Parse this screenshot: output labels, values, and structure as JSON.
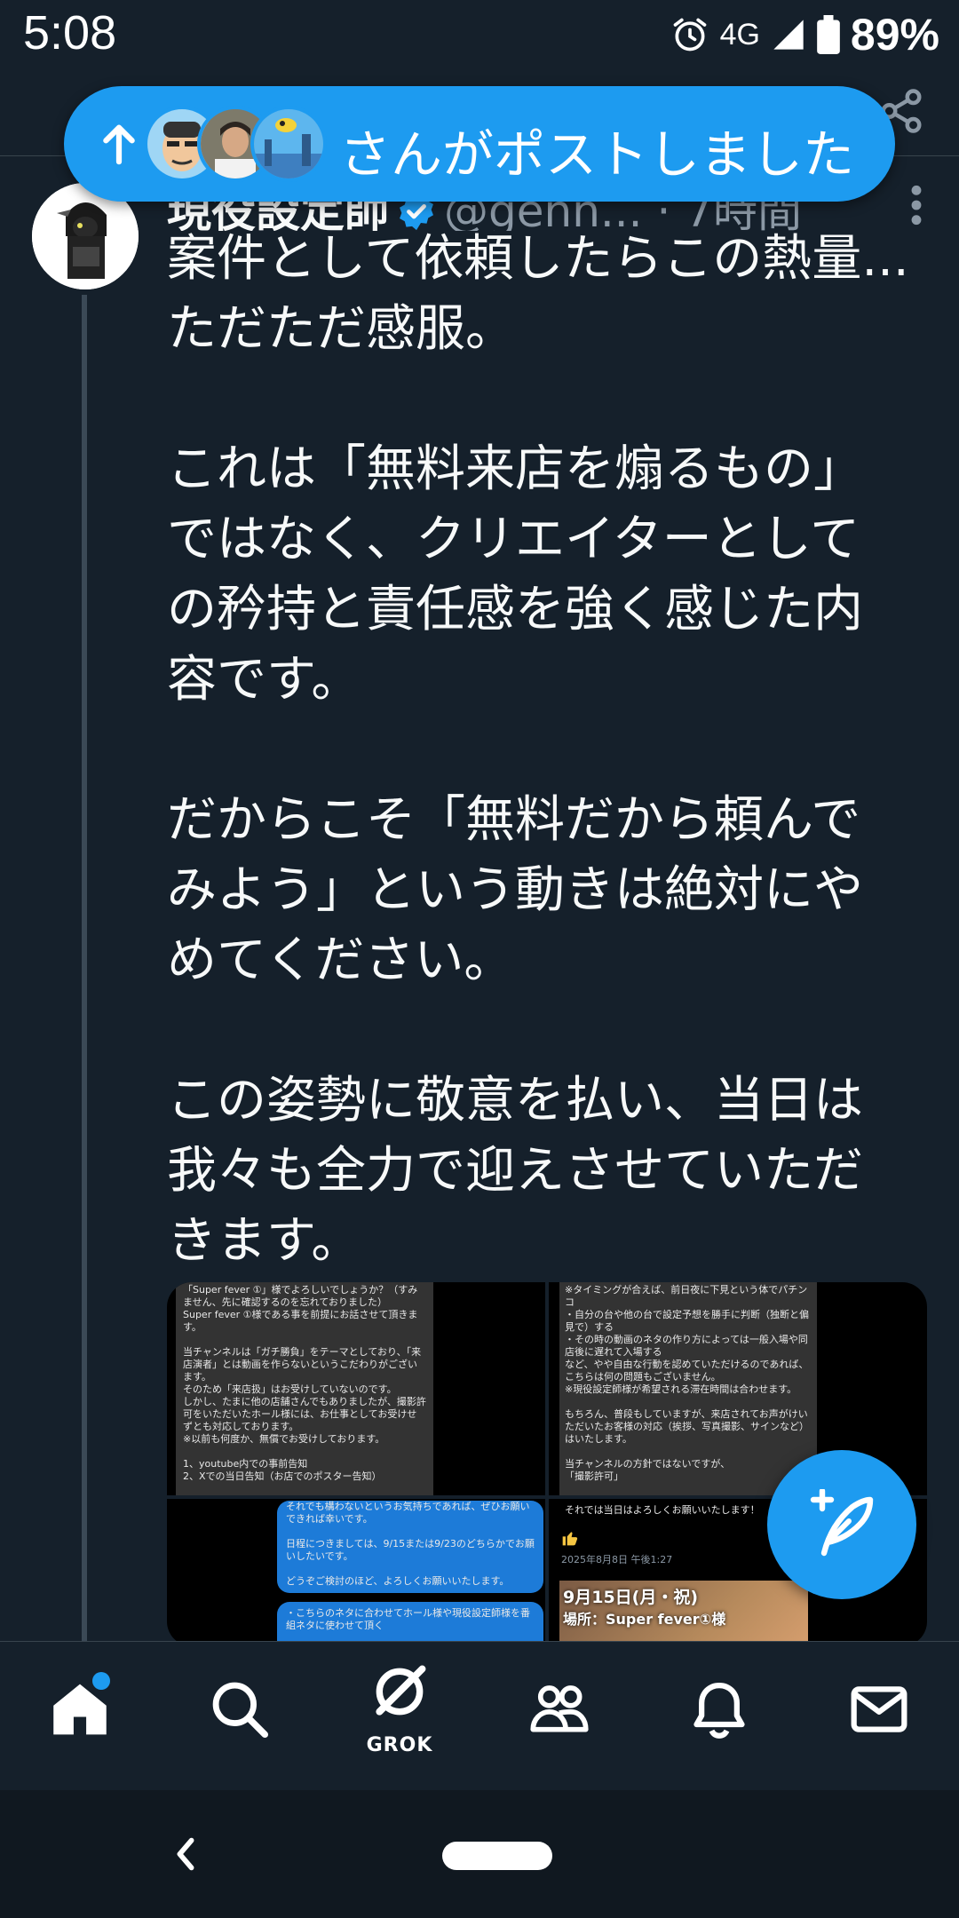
{
  "status_bar": {
    "time": "5:08",
    "network": "4G",
    "battery": "89%",
    "icons": [
      "alarm-icon",
      "signal-icon",
      "battery-icon"
    ]
  },
  "new_posts_pill": {
    "text": "さんがポストしました",
    "icon": "arrow-up-icon",
    "avatar_count": 3
  },
  "tweet": {
    "author_name": "現役設定師",
    "handle_time": "@genn... · 7時間",
    "text": "案件として依頼したらこの熱量...\nただただ感服。\n\nこれは「無料来店を煽るもの」\nではなく、クリエイターとして\nの矜持と責任感を強く感じた内\n容です。\n\nだからこそ「無料だから頼んで\nみよう」という動きは絶対にや\nめてください。\n\nこの姿勢に敬意を払い、当日は\n我々も全力で迎えさせていただ\nきます。",
    "media": {
      "image1_text": "「Super fever ①」様でよろしいでしょうか？（すみません、先に確認するのを忘れておりました）\nSuper fever ①様である事を前提にお話させて頂きます。\n\n当チャンネルは「ガチ勝負」をテーマとしており、「来店演者」とは動画を作らないというこだわりがございます。\nそのため「来店扱」はお受けしていないのです。\nしかし、たまに他の店舗さんでもありましたが、撮影許可をいただいたホール様には、お仕事としてお受けせずとも対応しております。\n※以前も何度か、無償でお受けしております。\n\n1、youtube内での事前告知\n2、Xでの当日告知（お店でのポスター告知）",
      "image2_text": "※タイミングが合えば、前日夜に下見という体でパチンコ\n・自分の台や他の台で設定予想を勝手に判断（独断と偏見で）する\n・その時の動画のネタの作り方によっては一般入場や同店後に遅れて入場する\nなど、やや自由な行動を認めていただけるのであれば、こちらは何の問題もございません。\n※現役設定師様が希望される滞在時間は合わせます。\n\nもちろん、普段もしていますが、来店されてお声がけいただいたお客様の対応（挨拶、写真撮影、サインなど）はいたします。\n\n当チャンネルの方針ではないですが、\n「撮影許可」",
      "image3_text_a": "それでも構わないというお気持ちであれば、ぜひお願いできれば幸いです。\n\n日程につきましては、9/15または9/23のどちらかでお願いしたいです。\n\nどうぞご検討のほど、よろしくお願いいたします。",
      "image3_text_b": "・こちらのネタに合わせてホール様や現役設定師様を番組ネタに使わせて頂く",
      "image4_text_a": "それでは当日はよろしくお願いいたします！",
      "image4_time": "2025年8月8日 午後1:27",
      "image4_poster_title": "9月15日(月・祝)",
      "image4_poster_sub": "場所：Super fever①様"
    }
  },
  "bottom_nav": {
    "items": [
      {
        "name": "home",
        "icon": "home-icon"
      },
      {
        "name": "search",
        "icon": "search-icon"
      },
      {
        "name": "grok",
        "icon": "grok-icon",
        "label": "GROK"
      },
      {
        "name": "communities",
        "icon": "people-icon"
      },
      {
        "name": "notifications",
        "icon": "bell-icon"
      },
      {
        "name": "messages",
        "icon": "mail-icon"
      }
    ]
  },
  "colors": {
    "background": "#15202b",
    "accent": "#1d9bf0",
    "secondary_text": "#8b98a5"
  }
}
